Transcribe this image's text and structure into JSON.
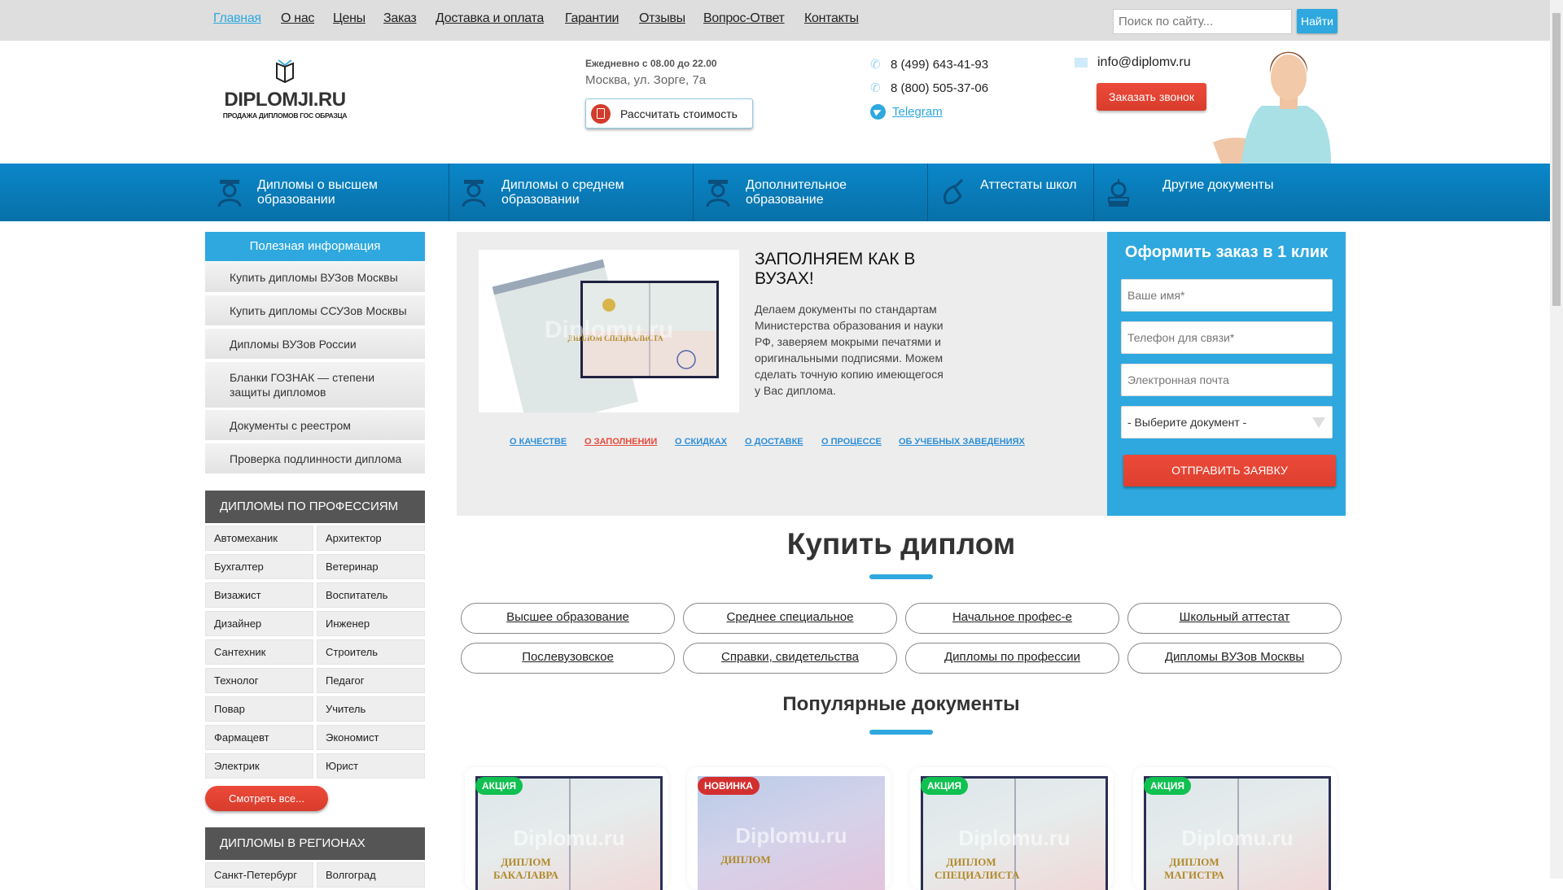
{
  "topnav": {
    "items": [
      "Главная",
      "О нас",
      "Цены",
      "Заказ",
      "Доставка и оплата",
      "Гарантии",
      "Отзывы",
      "Вопрос-Ответ",
      "Контакты"
    ],
    "search_placeholder": "Поиск по сайту...",
    "search_button": "Найти"
  },
  "header": {
    "logo_title": "DIPLOMJI.RU",
    "logo_subtitle": "ПРОДАЖА ДИПЛОМОВ ГОС ОБРАЗЦА",
    "hours": "Ежедневно с 08.00 до 22.00",
    "address": "Москва, ул. Зорге, 7а",
    "calc_button": "Рассчитать стоимость",
    "phone1": "8 (499) 643-41-93",
    "phone2": "8 (800) 505-37-06",
    "telegram": "Telegram",
    "email": "info@diplomv.ru",
    "call_button": "Заказать звонок"
  },
  "mainnav": [
    "Дипломы о высшем образовании",
    "Дипломы о среднем образовании",
    "Дополнительное образование",
    "Аттестаты школ",
    "Другие документы"
  ],
  "sidebar": {
    "title": "Полезная информация",
    "items": [
      "Купить дипломы ВУЗов Москвы",
      "Купить дипломы ССУЗов Москвы",
      "Дипломы ВУЗов России",
      "Бланки ГОЗНАК — степени защиты дипломов",
      "Документы с реестром",
      "Проверка подлинности диплома"
    ],
    "professions_title": "ДИПЛОМЫ ПО ПРОФЕССИЯМ",
    "professions": [
      "Автомеханик",
      "Архитектор",
      "Бухгалтер",
      "Ветеринар",
      "Визажист",
      "Воспитатель",
      "Дизайнер",
      "Инженер",
      "Сантехник",
      "Строитель",
      "Технолог",
      "Педагог",
      "Повар",
      "Учитель",
      "Фармацевт",
      "Экономист",
      "Электрик",
      "Юрист"
    ],
    "more_button": "Смотреть все...",
    "regions_title": "ДИПЛОМЫ В РЕГИОНАХ",
    "regions": [
      "Санкт-Петербург",
      "Волгоград"
    ]
  },
  "slider": {
    "title": "ЗАПОЛНЯЕМ КАК В ВУЗАХ!",
    "text": "Делаем документы по стандартам Министерства образования и науки РФ, заверяем мокрыми печатями и оригинальными подписями. Можем сделать точную копию имеющегося у Вас диплома.",
    "image_watermark": "Diplomu.ru",
    "image_label": "ДИПЛОМ СПЕЦИАЛИСТА",
    "tabs": [
      "О КАЧЕСТВЕ",
      "О ЗАПОЛНЕНИИ",
      "О СКИДКАХ",
      "О ДОСТАВКЕ",
      "О ПРОЦЕССЕ",
      "ОБ УЧЕБНЫХ ЗАВЕДЕНИЯХ"
    ],
    "active_tab": "О ЗАПОЛНЕНИИ"
  },
  "form": {
    "title": "Оформить заказ в 1 клик",
    "name_placeholder": "Ваше имя*",
    "phone_placeholder": "Телефон для связи*",
    "email_placeholder": "Электронная почта",
    "select_value": "- Выберите документ -",
    "submit": "ОТПРАВИТЬ ЗАЯВКУ"
  },
  "buy": {
    "title": "Купить диплом",
    "links": [
      "Высшее образование",
      "Среднее специальное",
      "Начальное профес-е",
      "Школьный аттестат",
      "Послевузовское",
      "Справки, свидетельства",
      "Дипломы по профессии",
      "Дипломы ВУЗов Москвы"
    ]
  },
  "popular": {
    "title": "Популярные документы",
    "cards": [
      {
        "badge": "АКЦИЯ",
        "label": "ДИПЛОМ БАКАЛАВРА"
      },
      {
        "badge": "НОВИНКА",
        "label": "ДИПЛОМ"
      },
      {
        "badge": "АКЦИЯ",
        "label": "ДИПЛОМ СПЕЦИАЛИСТА"
      },
      {
        "badge": "АКЦИЯ",
        "label": "ДИПЛОМ МАГИСТРА"
      }
    ],
    "watermark": "Diplomu.ru"
  },
  "colors": {
    "accent": "#2ea8df",
    "nav_blue": "#0a87c9",
    "cta_red": "#e84a3c",
    "badge_green": "#10c050",
    "badge_red": "#d32f2f",
    "dark_header": "#555555"
  }
}
